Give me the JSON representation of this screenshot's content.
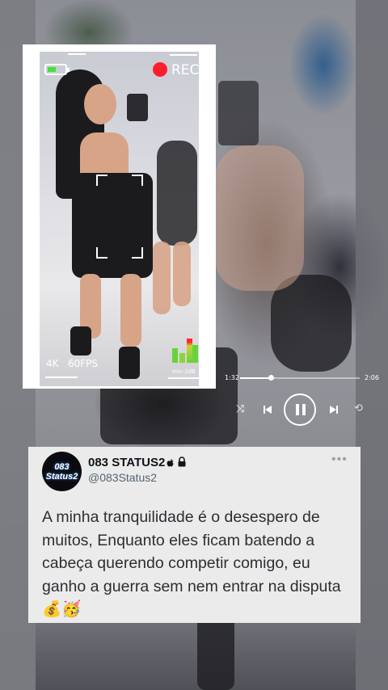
{
  "camera_overlay": {
    "rec_label": "REC",
    "quality_label": "4K",
    "fps_label": "60FPS",
    "mic_label": "mic-2dB",
    "battery_level": 0.5,
    "rec_color": "#ff1e2d",
    "battery_color": "#3fe33b"
  },
  "player": {
    "elapsed": "1:32",
    "total": "2:06",
    "progress": 0.26,
    "icons": [
      "shuffle-icon",
      "previous-icon",
      "pause-icon",
      "next-icon",
      "repeat-icon"
    ]
  },
  "tweet": {
    "avatar_text": "083 Status2",
    "display_name": "083 STATUS2",
    "handle": "@083Status2",
    "more_label": "•••",
    "text": "A minha tranquilidade é o desespero de muitos, Enquanto eles ficam batendo a cabeça querendo competir comigo, eu ganho a guerra sem nem entrar na disputa 💰🥳"
  }
}
